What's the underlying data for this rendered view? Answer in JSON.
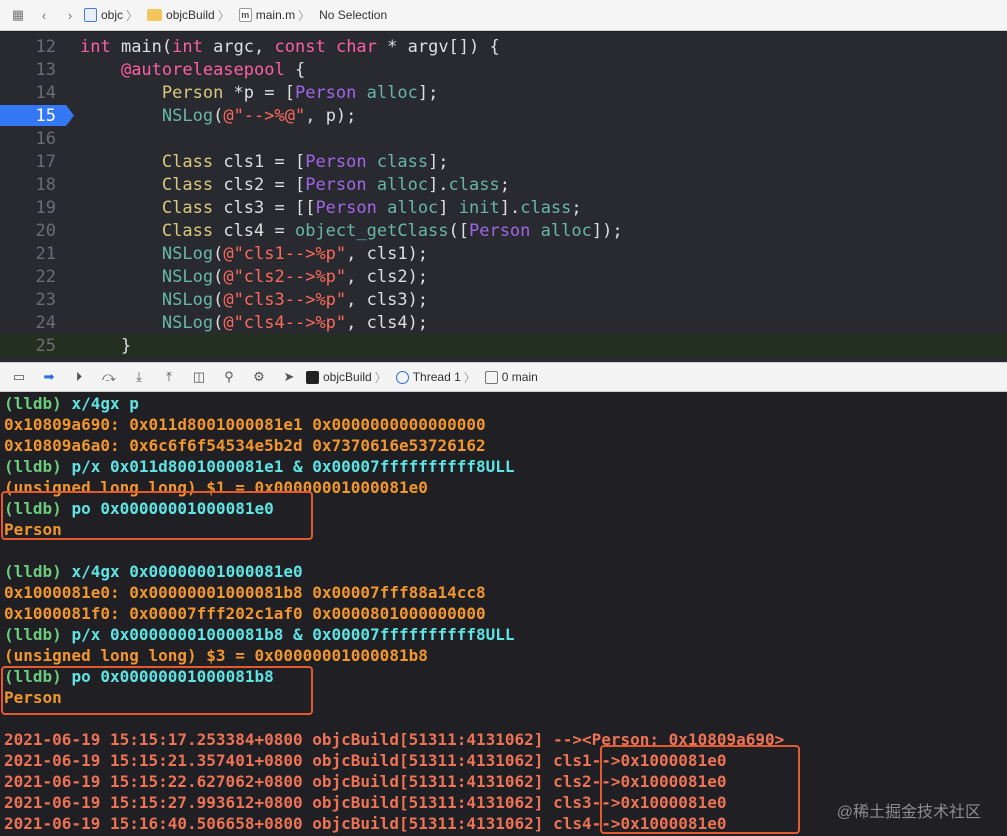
{
  "jumpbar": {
    "crumbs": [
      "objc",
      "objcBuild",
      "main.m",
      "No Selection"
    ]
  },
  "editor": {
    "lines": [
      {
        "num": "12",
        "parts": [
          [
            "kw",
            "int"
          ],
          [
            "plain",
            " main("
          ],
          [
            "kw",
            "int"
          ],
          [
            "plain",
            " argc, "
          ],
          [
            "kw",
            "const"
          ],
          [
            "plain",
            " "
          ],
          [
            "kw",
            "char"
          ],
          [
            "plain",
            " * argv[]) {"
          ]
        ]
      },
      {
        "num": "13",
        "parts": [
          [
            "plain",
            "    "
          ],
          [
            "kw",
            "@autoreleasepool"
          ],
          [
            "plain",
            " {"
          ]
        ]
      },
      {
        "num": "14",
        "parts": [
          [
            "plain",
            "        "
          ],
          [
            "cl-type",
            "Person"
          ],
          [
            "plain",
            " *p = ["
          ],
          [
            "persons",
            "Person"
          ],
          [
            "plain",
            " "
          ],
          [
            "mth",
            "alloc"
          ],
          [
            "plain",
            "];"
          ]
        ]
      },
      {
        "num": "15",
        "parts": [
          [
            "plain",
            "        "
          ],
          [
            "mth",
            "NSLog"
          ],
          [
            "plain",
            "("
          ],
          [
            "str",
            "@\"-->%@\""
          ],
          [
            "plain",
            ", p);"
          ]
        ]
      },
      {
        "num": "16",
        "parts": []
      },
      {
        "num": "17",
        "parts": [
          [
            "plain",
            "        "
          ],
          [
            "cl-type",
            "Class"
          ],
          [
            "plain",
            " cls1 = ["
          ],
          [
            "persons",
            "Person"
          ],
          [
            "plain",
            " "
          ],
          [
            "mth",
            "class"
          ],
          [
            "plain",
            "];"
          ]
        ]
      },
      {
        "num": "18",
        "parts": [
          [
            "plain",
            "        "
          ],
          [
            "cl-type",
            "Class"
          ],
          [
            "plain",
            " cls2 = ["
          ],
          [
            "persons",
            "Person"
          ],
          [
            "plain",
            " "
          ],
          [
            "mth",
            "alloc"
          ],
          [
            "plain",
            "]."
          ],
          [
            "mth",
            "class"
          ],
          [
            "plain",
            ";"
          ]
        ]
      },
      {
        "num": "19",
        "parts": [
          [
            "plain",
            "        "
          ],
          [
            "cl-type",
            "Class"
          ],
          [
            "plain",
            " cls3 = [["
          ],
          [
            "persons",
            "Person"
          ],
          [
            "plain",
            " "
          ],
          [
            "mth",
            "alloc"
          ],
          [
            "plain",
            "] "
          ],
          [
            "mth",
            "init"
          ],
          [
            "plain",
            "]."
          ],
          [
            "mth",
            "class"
          ],
          [
            "plain",
            ";"
          ]
        ]
      },
      {
        "num": "20",
        "parts": [
          [
            "plain",
            "        "
          ],
          [
            "cl-type",
            "Class"
          ],
          [
            "plain",
            " cls4 = "
          ],
          [
            "mth",
            "object_getClass"
          ],
          [
            "plain",
            "(["
          ],
          [
            "persons",
            "Person"
          ],
          [
            "plain",
            " "
          ],
          [
            "mth",
            "alloc"
          ],
          [
            "plain",
            "]);"
          ]
        ]
      },
      {
        "num": "21",
        "parts": [
          [
            "plain",
            "        "
          ],
          [
            "mth",
            "NSLog"
          ],
          [
            "plain",
            "("
          ],
          [
            "str",
            "@\"cls1-->%p\""
          ],
          [
            "plain",
            ", cls1);"
          ]
        ]
      },
      {
        "num": "22",
        "parts": [
          [
            "plain",
            "        "
          ],
          [
            "mth",
            "NSLog"
          ],
          [
            "plain",
            "("
          ],
          [
            "str",
            "@\"cls2-->%p\""
          ],
          [
            "plain",
            ", cls2);"
          ]
        ]
      },
      {
        "num": "23",
        "parts": [
          [
            "plain",
            "        "
          ],
          [
            "mth",
            "NSLog"
          ],
          [
            "plain",
            "("
          ],
          [
            "str",
            "@\"cls3-->%p\""
          ],
          [
            "plain",
            ", cls3);"
          ]
        ]
      },
      {
        "num": "24",
        "parts": [
          [
            "plain",
            "        "
          ],
          [
            "mth",
            "NSLog"
          ],
          [
            "plain",
            "("
          ],
          [
            "str",
            "@\"cls4-->%p\""
          ],
          [
            "plain",
            ", cls4);"
          ]
        ]
      },
      {
        "num": "25",
        "parts": [
          [
            "plain",
            "    }"
          ]
        ]
      }
    ],
    "breakpoint_line": "15"
  },
  "debugbar": {
    "crumbs": [
      "objcBuild",
      "Thread 1",
      "0 main"
    ]
  },
  "console": {
    "lines": [
      [
        [
          "c-green",
          "(lldb) "
        ],
        [
          "c-cyan",
          "x/4gx p"
        ]
      ],
      [
        [
          "c-orange",
          "0x10809a690: 0x011d8001000081e1 0x0000000000000000"
        ]
      ],
      [
        [
          "c-orange",
          "0x10809a6a0: 0x6c6f6f54534e5b2d 0x7370616e53726162"
        ]
      ],
      [
        [
          "c-green",
          "(lldb) "
        ],
        [
          "c-cyan",
          "p/x 0x011d8001000081e1 & 0x00007ffffffffff8ULL"
        ]
      ],
      [
        [
          "c-orange",
          "(unsigned long long) $1 = 0x00000001000081e0"
        ]
      ],
      [
        [
          "c-green",
          "(lldb) "
        ],
        [
          "c-cyan",
          "po 0x00000001000081e0"
        ]
      ],
      [
        [
          "c-orange",
          "Person"
        ]
      ],
      [],
      [
        [
          "c-green",
          "(lldb) "
        ],
        [
          "c-cyan",
          "x/4gx 0x00000001000081e0"
        ]
      ],
      [
        [
          "c-orange",
          "0x1000081e0: 0x00000001000081b8 0x00007fff88a14cc8"
        ]
      ],
      [
        [
          "c-orange",
          "0x1000081f0: 0x00007fff202c1af0 0x0000801000000000"
        ]
      ],
      [
        [
          "c-green",
          "(lldb) "
        ],
        [
          "c-cyan",
          "p/x 0x00000001000081b8 & 0x00007ffffffffff8ULL"
        ]
      ],
      [
        [
          "c-orange",
          "(unsigned long long) $3 = 0x00000001000081b8"
        ]
      ],
      [
        [
          "c-green",
          "(lldb) "
        ],
        [
          "c-cyan",
          "po 0x00000001000081b8"
        ]
      ],
      [
        [
          "c-orange",
          "Person"
        ]
      ],
      [],
      [
        [
          "c-red",
          "2021-06-19 15:15:17.253384+0800 objcBuild[51311:4131062] --><Person: 0x10809a690>"
        ]
      ],
      [
        [
          "c-red",
          "2021-06-19 15:15:21.357401+0800 objcBuild[51311:4131062] cls1-->0x1000081e0"
        ]
      ],
      [
        [
          "c-red",
          "2021-06-19 15:15:22.627062+0800 objcBuild[51311:4131062] cls2-->0x1000081e0"
        ]
      ],
      [
        [
          "c-red",
          "2021-06-19 15:15:27.993612+0800 objcBuild[51311:4131062] cls3-->0x1000081e0"
        ]
      ],
      [
        [
          "c-red",
          "2021-06-19 15:16:40.506658+0800 objcBuild[51311:4131062] cls4-->0x1000081e0"
        ]
      ]
    ]
  },
  "watermark": "@稀土掘金技术社区",
  "colors": {
    "breakpoint": "#3478f6",
    "annotation_box": "#e45a30"
  }
}
